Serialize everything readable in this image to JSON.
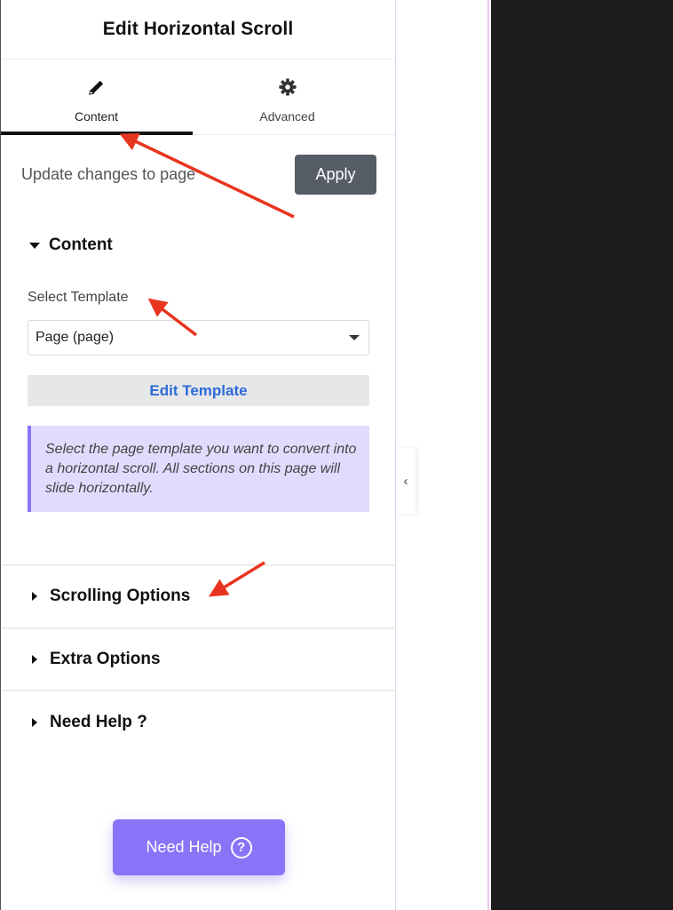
{
  "panel": {
    "title": "Edit Horizontal Scroll",
    "tabs": [
      {
        "label": "Content",
        "icon": "pencil-icon",
        "active": true
      },
      {
        "label": "Advanced",
        "icon": "gear-icon",
        "active": false
      }
    ]
  },
  "apply_row": {
    "text": "Update changes to page",
    "button_label": "Apply"
  },
  "content_section": {
    "title": "Content",
    "select_label": "Select Template",
    "select_value": "Page (page)",
    "edit_template_label": "Edit Template",
    "notice": "Select the page template you want to convert into a horizontal scroll. All sections on this page will slide horizontally."
  },
  "collapsed_sections": [
    {
      "title": "Scrolling Options"
    },
    {
      "title": "Extra Options"
    },
    {
      "title": "Need Help ?"
    }
  ],
  "help_button": {
    "label": "Need Help",
    "icon": "question-circle-icon",
    "icon_glyph": "?"
  },
  "collapse_toggle": {
    "icon": "chevron-left-icon",
    "glyph": "‹"
  },
  "colors": {
    "accent": "#8b73f7",
    "notice_bg": "#e3dbfd",
    "link": "#2e6ad8",
    "apply_bg": "#565d66",
    "annotation_arrow": "#e8351f",
    "dark_area": "#1c1b1d"
  }
}
